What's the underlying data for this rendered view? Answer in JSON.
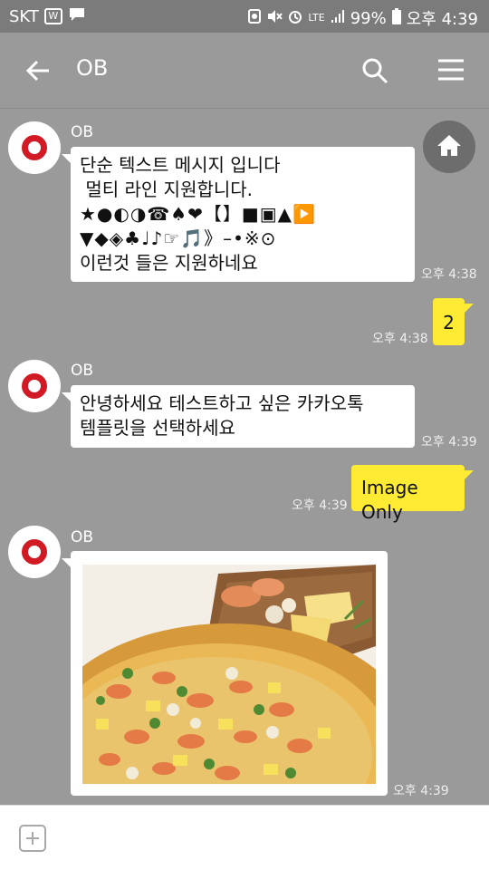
{
  "status_bar": {
    "carrier": "SKT",
    "network": "LTE",
    "battery": "99%",
    "clock": "오후 4:39",
    "icons": [
      "shield-icon",
      "chat-icon",
      "recycle-icon",
      "mute-icon",
      "alarm-icon",
      "signal-icon",
      "battery-icon"
    ]
  },
  "app_bar": {
    "title": "OB",
    "icons": [
      "back-arrow-icon",
      "search-icon",
      "menu-icon"
    ]
  },
  "messages": [
    {
      "direction": "in",
      "sender": "OB",
      "lines": [
        "단순 텍스트 메시지 입니다",
        " 멀티 라인 지원합니다.",
        "★●◐◑☎♠❤【】■▣▲▶️",
        "▼◆◈♣♩♪☞🎵》–•※⊙",
        "이런것 들은 지원하네요"
      ],
      "time": "오후 4:38"
    },
    {
      "direction": "out",
      "text": "2",
      "time": "오후 4:38"
    },
    {
      "direction": "in",
      "sender": "OB",
      "lines": [
        "안녕하세요 테스트하고 싶은 카카오톡",
        "템플릿을 선택하세요"
      ],
      "time": "오후 4:39"
    },
    {
      "direction": "out",
      "text": "Image Only",
      "time": "오후 4:39"
    },
    {
      "direction": "in",
      "sender": "OB",
      "image": "pizza-photo",
      "time": "오후 4:39"
    }
  ],
  "floating": {
    "icon": "home-icon"
  },
  "input_bar": {
    "icon": "plus-icon"
  },
  "colors": {
    "background": "#9a9a9a",
    "outgoing_bubble": "#ffeb33",
    "incoming_bubble": "#ffffff",
    "avatar_ring": "#d11a24"
  }
}
